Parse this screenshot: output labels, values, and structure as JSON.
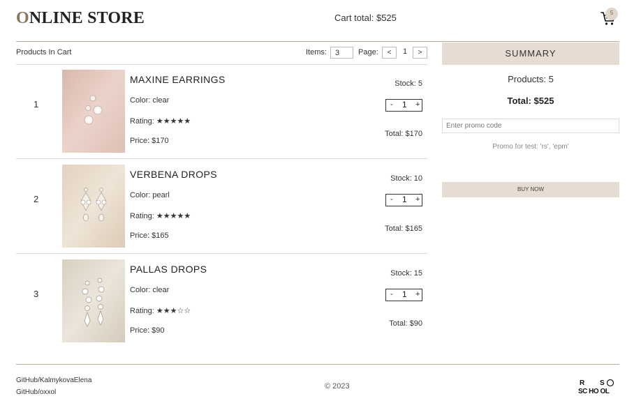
{
  "header": {
    "logo_first": "O",
    "logo_rest": "NLINE STORE",
    "cart_total": "Cart total: $525",
    "cart_count": "5"
  },
  "cart": {
    "title": "Products In Cart",
    "items_label": "Items:",
    "items_value": "3",
    "page_label": "Page:",
    "page_prev": "<",
    "page_number": "1",
    "page_next": ">"
  },
  "products": [
    {
      "index": "1",
      "name": "MAXINE EARRINGS",
      "color": "Color: clear",
      "rating": "Rating: ★★★★★",
      "price": "Price: $170",
      "stock": "Stock: 5",
      "qty": "1",
      "total": "Total: $170",
      "image_color": "#e8cdc4"
    },
    {
      "index": "2",
      "name": "VERBENA DROPS",
      "color": "Color: pearl",
      "rating": "Rating: ★★★★★",
      "price": "Price: $165",
      "stock": "Stock: 10",
      "qty": "1",
      "total": "Total: $165",
      "image_color": "#e9dccb"
    },
    {
      "index": "3",
      "name": "PALLAS DROPS",
      "color": "Color: clear",
      "rating": "Rating: ★★★☆☆",
      "price": "Price: $90",
      "stock": "Stock: 15",
      "qty": "1",
      "total": "Total: $90",
      "image_color": "#e3dccf"
    }
  ],
  "stepper": {
    "minus": "-",
    "plus": "+"
  },
  "summary": {
    "title": "SUMMARY",
    "products": "Products: 5",
    "total": "Total: $525",
    "promo_placeholder": "Enter promo code",
    "promo_hint": "Promo for test: 'rs', 'epm'",
    "buy_label": "BUY NOW"
  },
  "footer": {
    "github1": "GitHub/KalmykovaElena",
    "github2": "GitHub/oxxol",
    "copyright": "© 2023",
    "rs_logo": "RS SCHOOL"
  },
  "colors": {
    "accent": "#e6dcd2",
    "divider": "#b9a995",
    "logo_first_letter": "#8a7660"
  }
}
